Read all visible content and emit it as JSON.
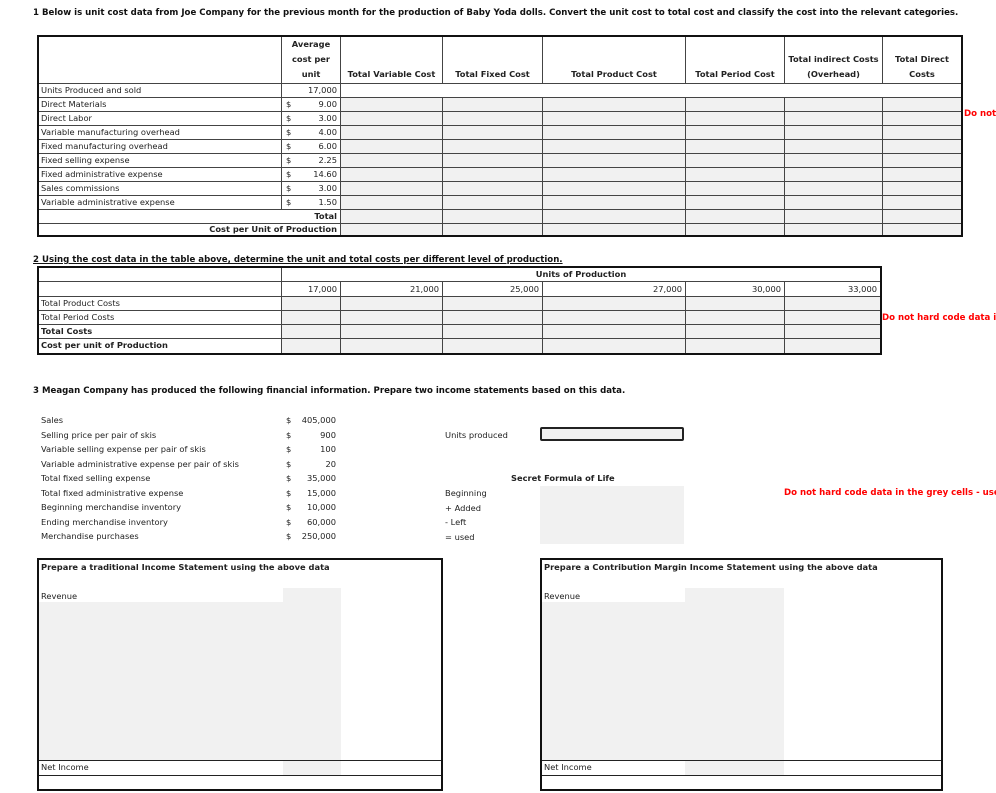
{
  "q1": {
    "title": "1  Below is unit cost data from Joe Company for the previous month for the production of Baby Yoda dolls.  Convert the unit cost to total cost and classify the cost into the relevant categories.",
    "headers": {
      "avg_cost": "Average cost per unit",
      "avg_line1": "Average",
      "avg_line2": "cost per",
      "avg_line3": "unit",
      "total_variable": "Total Variable Cost",
      "total_fixed": "Total Fixed Cost",
      "total_product": "Total Product Cost",
      "total_period": "Total Period Cost",
      "indirect_line1": "Total indirect Costs",
      "indirect_line2": "(Overhead)",
      "direct_line1": "Total Direct",
      "direct_line2": "Costs"
    },
    "units_row": {
      "label": "Units Produced and sold",
      "value": "17,000"
    },
    "rows": [
      {
        "label": "Direct Materials",
        "currency": "$",
        "value": "9.00"
      },
      {
        "label": "Direct Labor",
        "currency": "$",
        "value": "3.00"
      },
      {
        "label": "Variable manufacturing overhead",
        "currency": "$",
        "value": "4.00"
      },
      {
        "label": "Fixed manufacturing overhead",
        "currency": "$",
        "value": "6.00"
      },
      {
        "label": "Fixed selling expense",
        "currency": "$",
        "value": "2.25"
      },
      {
        "label": "Fixed administrative expense",
        "currency": "$",
        "value": "14.60"
      },
      {
        "label": "Sales commissions",
        "currency": "$",
        "value": "3.00"
      },
      {
        "label": "Variable administrative expense",
        "currency": "$",
        "value": "1.50"
      }
    ],
    "total_label": "Total",
    "cost_per_unit_label": "Cost per Unit of Production",
    "warning": "Do not"
  },
  "q2": {
    "title": "2  Using the cost data in the table above, determine the unit and total costs per different level of production.",
    "units_header": "Units of Production",
    "levels": [
      "17,000",
      "21,000",
      "25,000",
      "27,000",
      "30,000",
      "33,000"
    ],
    "rows": [
      {
        "label": "Total Product Costs",
        "bold": false
      },
      {
        "label": "Total Period Costs",
        "bold": false
      },
      {
        "label": "Total Costs",
        "bold": true
      },
      {
        "label": "Cost per unit of Production",
        "bold": true
      }
    ],
    "warning": "Do not hard code data in"
  },
  "q3": {
    "title": "3  Meagan Company has produced the following financial information. Prepare two income statements based on this data.",
    "items": [
      {
        "label": "Sales",
        "currency": "$",
        "value": "405,000"
      },
      {
        "label": "Selling price per pair of skis",
        "currency": "$",
        "value": "900"
      },
      {
        "label": "Variable selling expense per pair of skis",
        "currency": "$",
        "value": "100"
      },
      {
        "label": "Variable administrative expense per pair of skis",
        "currency": "$",
        "value": "20"
      },
      {
        "label": "Total fixed selling expense",
        "currency": "$",
        "value": "35,000"
      },
      {
        "label": "Total fixed administrative expense",
        "currency": "$",
        "value": "15,000"
      },
      {
        "label": "Beginning merchandise inventory",
        "currency": "$",
        "value": "10,000"
      },
      {
        "label": "Ending merchandise inventory",
        "currency": "$",
        "value": "60,000"
      },
      {
        "label": "Merchandise purchases",
        "currency": "$",
        "value": "250,000"
      }
    ],
    "units_produced_label": "Units produced",
    "units_produced_value": "",
    "formula_title": "Secret Formula of Life",
    "formula_rows": [
      "Beginning",
      "+ Added",
      "- Left",
      "= used"
    ],
    "warning": "Do not hard code data in the grey cells - use f",
    "traditional": {
      "title": "Prepare a traditional Income Statement using the above data",
      "revenue_label": "Revenue",
      "net_income_label": "Net Income"
    },
    "contribution": {
      "title": "Prepare a Contribution Margin Income Statement using the above data",
      "revenue_label": "Revenue",
      "net_income_label": "Net Income"
    }
  }
}
